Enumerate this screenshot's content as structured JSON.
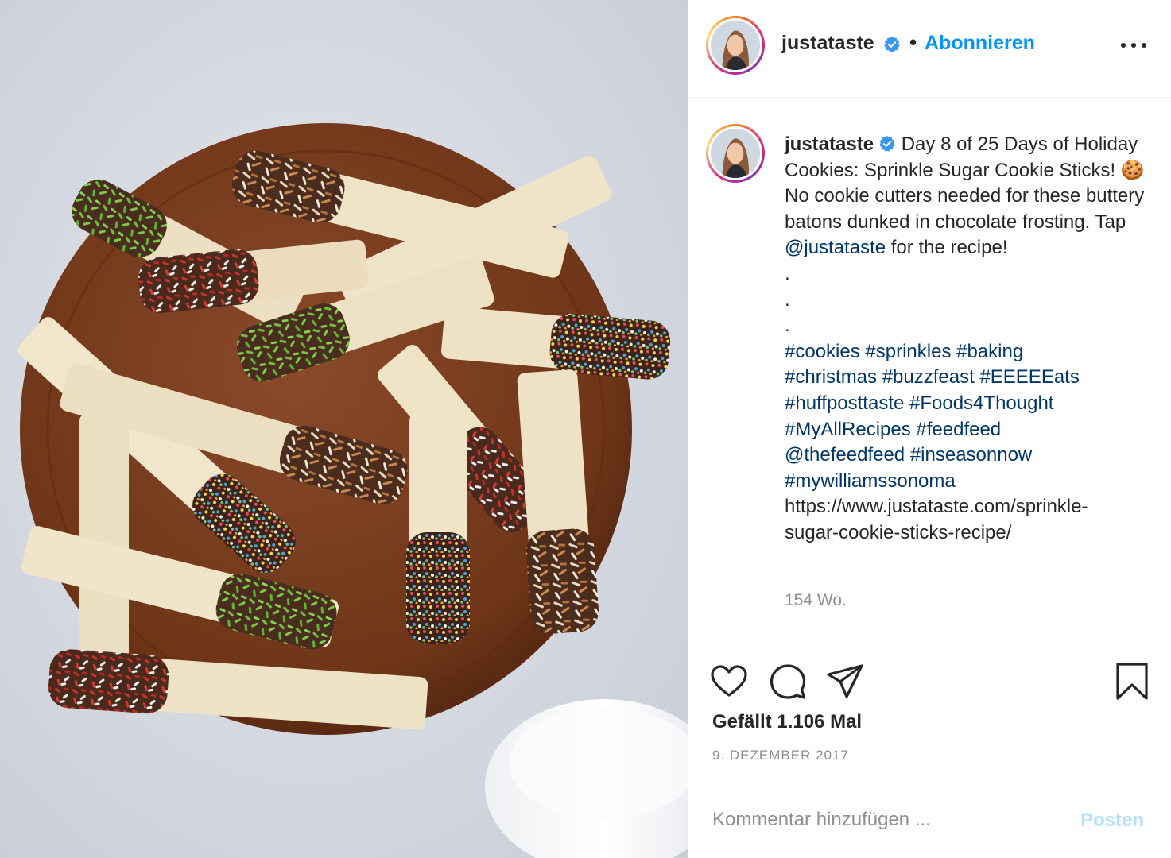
{
  "post": {
    "username": "justataste",
    "verified": true,
    "follow_label": "Abonnieren",
    "separator": "•",
    "caption": {
      "segment_1": "Day 8 of 25 Days of Holiday Cookies: Sprinkle Sugar Cookie Sticks! 🍪 No cookie cutters needed for these buttery batons dunked in chocolate frosting. Tap ",
      "mention": "@justataste",
      "segment_2": " for the recipe!",
      "dots": [
        ".",
        ".",
        "."
      ],
      "hashtags_line_1": "#cookies #sprinkles #baking",
      "hashtags_line_2": "#christmas #buzzfeast #EEEEEats",
      "hashtags_line_3": "#huffposttaste #Foods4Thought",
      "hashtags_line_4": "#MyAllRecipes #feedfeed",
      "hashtags_line_5": "@thefeedfeed #inseasonnow",
      "hashtags_line_6": "#mywilliamssonoma",
      "url_line_1": "https://www.justataste.com/sprinkle-",
      "url_line_2": "sugar-cookie-sticks-recipe/"
    },
    "caption_age": "154 Wo.",
    "likes_text": "Gefällt 1.106 Mal",
    "date": "9. DEZEMBER 2017",
    "comment_placeholder": "Kommentar hinzufügen ...",
    "post_label": "Posten"
  },
  "icons": {
    "like": "heart-icon",
    "comment": "speech-bubble-icon",
    "share": "paper-plane-icon",
    "save": "bookmark-icon",
    "more": "more-options-icon",
    "verified": "verified-badge-icon"
  },
  "colors": {
    "link_blue": "#0095f6",
    "hashtag_blue": "#00376b",
    "post_disabled": "#b2dffc",
    "muted_gray": "#8e8e8e",
    "verified_blue": "#3897f0"
  }
}
